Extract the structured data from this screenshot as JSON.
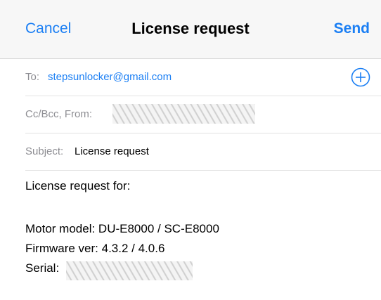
{
  "nav": {
    "cancel_label": "Cancel",
    "title": "License request",
    "send_label": "Send"
  },
  "fields": {
    "to_label": "To:",
    "to_value": "stepsunlocker@gmail.com",
    "add_icon": "plus-circle-icon",
    "cc_label": "Cc/Bcc, From:",
    "subject_label": "Subject:",
    "subject_value": "License request"
  },
  "body": {
    "line1": "License request for:",
    "motor_model": "Motor model: DU-E8000 / SC-E8000",
    "firmware": "Firmware ver: 4.3.2 / 4.0.6",
    "serial_label": "Serial:"
  },
  "colors": {
    "accent": "#1b7ff4",
    "label_gray": "#8e8e93",
    "nav_background": "#f7f7f7"
  }
}
